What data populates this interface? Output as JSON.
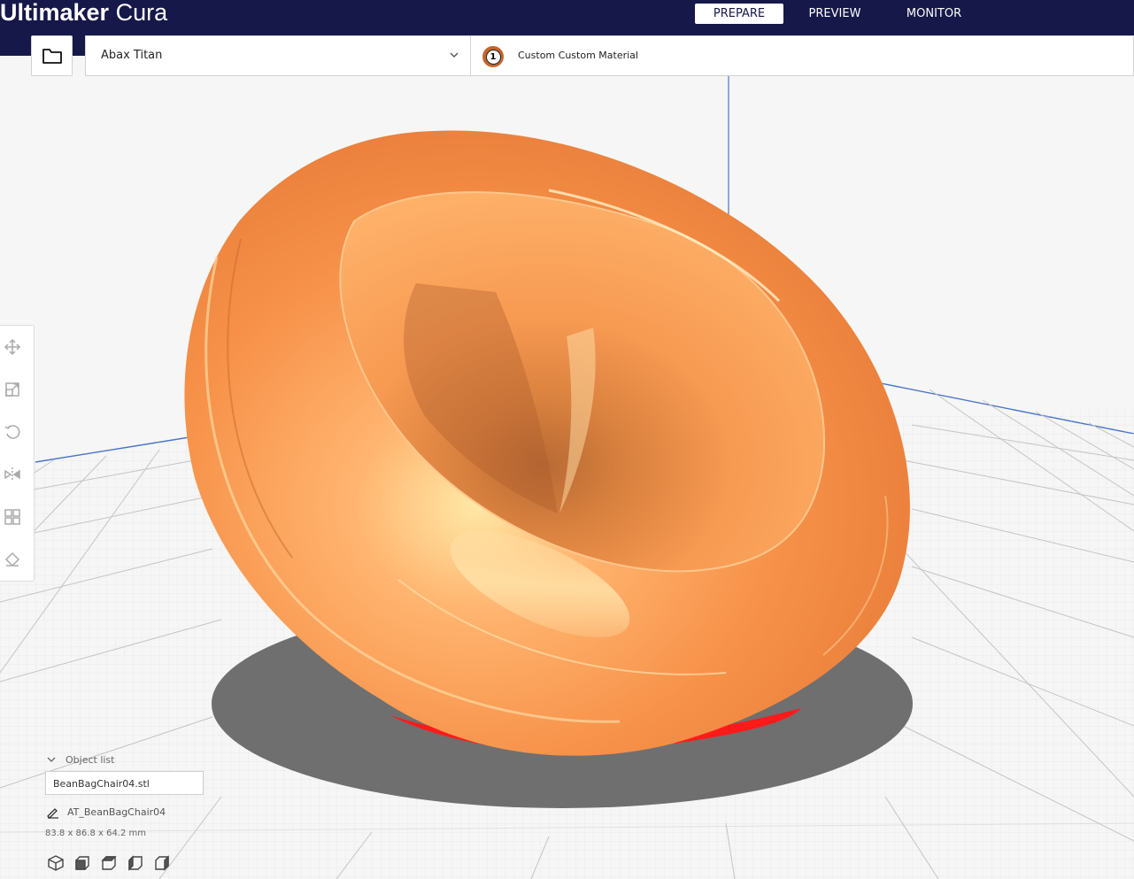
{
  "app": {
    "title_bold": "Ultimaker",
    "title_light": " Cura"
  },
  "stages": [
    {
      "label": "PREPARE",
      "active": true
    },
    {
      "label": "PREVIEW",
      "active": false
    },
    {
      "label": "MONITOR",
      "active": false
    }
  ],
  "printer": {
    "name": "Abax Titan"
  },
  "material": {
    "extruder_number": "1",
    "name": "Custom Custom Material"
  },
  "tools": [
    "move-icon",
    "scale-icon",
    "rotate-icon",
    "mirror-icon",
    "per-model-settings-icon",
    "support-blocker-icon"
  ],
  "object_list": {
    "header": "Object list",
    "items": [
      "BeanBagChair04.stl"
    ]
  },
  "model": {
    "name": "AT_BeanBagChair04",
    "dimensions": "83.8 x 86.8 x 64.2 mm"
  },
  "view_buttons": [
    "3d-view-icon",
    "front-view-icon",
    "top-view-icon",
    "left-view-icon",
    "right-view-icon"
  ],
  "colors": {
    "header": "#151848",
    "model": "#f5944a",
    "model_bottom_error": "#ff1a1a",
    "build_plate": "#f6f6f6",
    "grid": "#c6c6c6"
  }
}
